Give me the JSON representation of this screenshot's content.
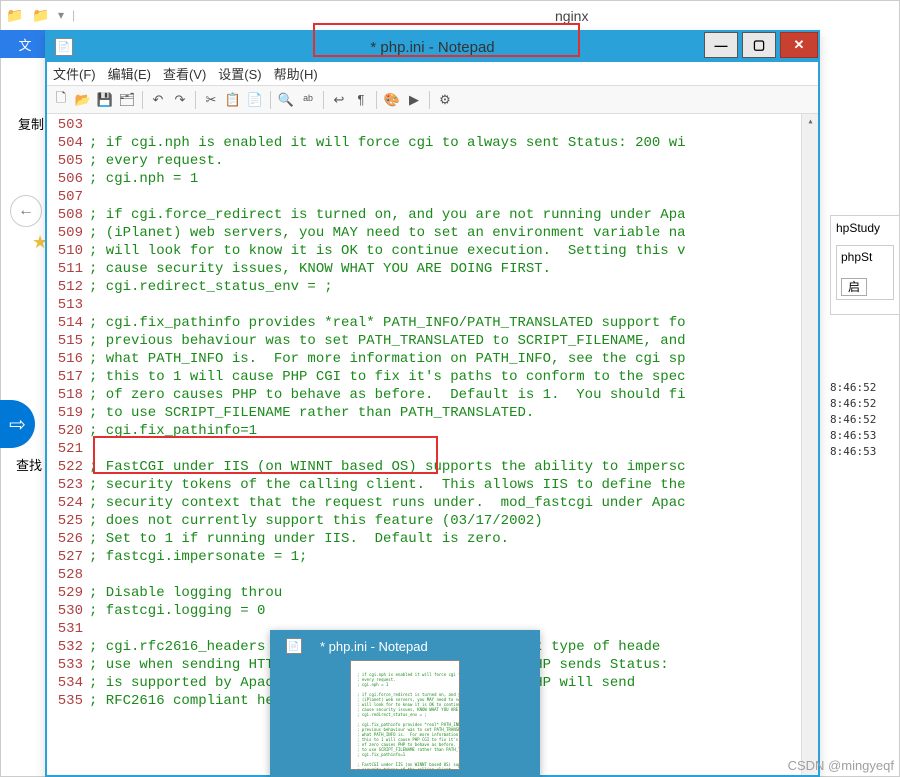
{
  "background": {
    "ribbon_tab": "文",
    "nav_back": "←",
    "share_icon": "⇨",
    "search_label": "查找",
    "copy_label": "复制",
    "star": "★",
    "title_nginx": "nginx",
    "right_panel_title": "hpStudy",
    "right_panel_text": "phpSt",
    "right_btn": "启",
    "log_times": [
      "8:46:52",
      "8:46:52",
      "8:46:52",
      "8:46:53",
      "8:46:53"
    ],
    "qat_folder": "📁"
  },
  "notepad": {
    "title": "* php.ini - Notepad",
    "icon": "📄",
    "controls": {
      "min": "—",
      "max": "▢",
      "close": "✕"
    },
    "menus": [
      "文件(F)",
      "编辑(E)",
      "查看(V)",
      "设置(S)",
      "帮助(H)"
    ],
    "toolbar": [
      {
        "name": "new",
        "glyph": "🗋"
      },
      {
        "name": "open",
        "glyph": "📂"
      },
      {
        "name": "save",
        "glyph": "💾"
      },
      {
        "name": "saveall",
        "glyph": "🗂"
      },
      {
        "sep": true
      },
      {
        "name": "undo",
        "glyph": "↶"
      },
      {
        "name": "redo",
        "glyph": "↷"
      },
      {
        "sep": true
      },
      {
        "name": "cut",
        "glyph": "✂"
      },
      {
        "name": "copy",
        "glyph": "📋"
      },
      {
        "name": "paste",
        "glyph": "📄"
      },
      {
        "sep": true
      },
      {
        "name": "find",
        "glyph": "🔍"
      },
      {
        "name": "replace",
        "glyph": "ᵃᵇ"
      },
      {
        "sep": true
      },
      {
        "name": "wrap",
        "glyph": "↩"
      },
      {
        "name": "ws",
        "glyph": "¶"
      },
      {
        "sep": true
      },
      {
        "name": "color",
        "glyph": "🎨"
      },
      {
        "name": "run",
        "glyph": "▶"
      },
      {
        "sep": true
      },
      {
        "name": "opts",
        "glyph": "⚙"
      }
    ],
    "first_line": 503,
    "lines": [
      "",
      "; if cgi.nph is enabled it will force cgi to always sent Status: 200 wi",
      "; every request.",
      "; cgi.nph = 1",
      "",
      "; if cgi.force_redirect is turned on, and you are not running under Apa",
      "; (iPlanet) web servers, you MAY need to set an environment variable na",
      "; will look for to know it is OK to continue execution.  Setting this v",
      "; cause security issues, KNOW WHAT YOU ARE DOING FIRST.",
      "; cgi.redirect_status_env = ;",
      "",
      "; cgi.fix_pathinfo provides *real* PATH_INFO/PATH_TRANSLATED support fo",
      "; previous behaviour was to set PATH_TRANSLATED to SCRIPT_FILENAME, and",
      "; what PATH_INFO is.  For more information on PATH_INFO, see the cgi sp",
      "; this to 1 will cause PHP CGI to fix it's paths to conform to the spec",
      "; of zero causes PHP to behave as before.  Default is 1.  You should fi",
      "; to use SCRIPT_FILENAME rather than PATH_TRANSLATED.",
      "; cgi.fix_pathinfo=1",
      "",
      "; FastCGI under IIS (on WINNT based OS) supports the ability to impersc",
      "; security tokens of the calling client.  This allows IIS to define the",
      "; security context that the request runs under.  mod_fastcgi under Apac",
      "; does not currently support this feature (03/17/2002)",
      "; Set to 1 if running under IIS.  Default is zero.",
      "; fastcgi.impersonate = 1;",
      "",
      "; Disable logging throu",
      "; fastcgi.logging = 0",
      "",
      "; cgi.rfc2616_headers c                           what type of heade",
      "; use when sending HTTP                           0 PHP sends Status:",
      "; is supported by Apach                           1 PHP will send",
      "; RFC2616 compliant hea"
    ],
    "scroll_up": "▴"
  },
  "thumb": {
    "title": "* php.ini - Notepad",
    "icon": "📄"
  },
  "watermark": "CSDN @mingyeqf"
}
